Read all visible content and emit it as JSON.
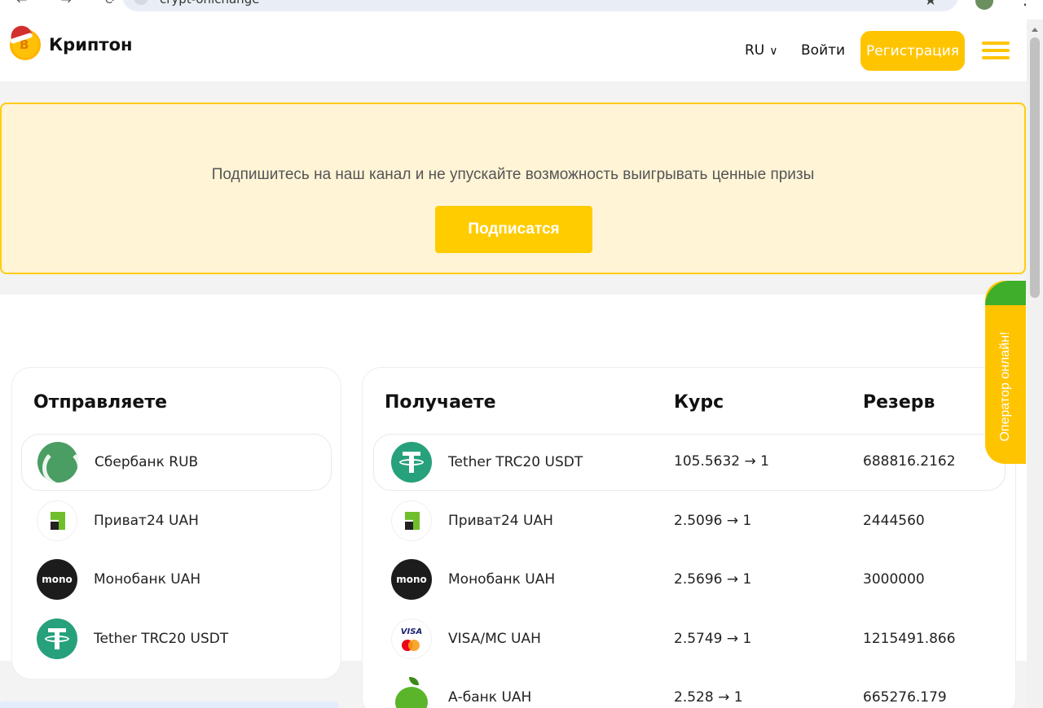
{
  "browser": {
    "url_text": "crypt-onlchange"
  },
  "header": {
    "logo_text": "Криптон",
    "lang": "RU",
    "login": "Войти",
    "register": "Регистрация"
  },
  "banner": {
    "text": "Подпишитесь на наш канал и не упускайте возможность выигрывать ценные призы",
    "button": "Подписатся"
  },
  "send": {
    "title": "Отправляете",
    "items": [
      {
        "name": "Сбербанк RUB",
        "icon": "sberbank-icon"
      },
      {
        "name": "Приват24 UAH",
        "icon": "privat24-icon"
      },
      {
        "name": "Монобанк UAH",
        "icon": "monobank-icon"
      },
      {
        "name": "Tether TRC20 USDT",
        "icon": "tether-icon"
      }
    ]
  },
  "receive": {
    "title": "Получаете",
    "rate_header": "Курс",
    "reserve_header": "Резерв",
    "items": [
      {
        "name": "Tether TRC20 USDT",
        "rate": "105.5632 → 1",
        "reserve": "688816.2162",
        "icon": "tether-icon"
      },
      {
        "name": "Приват24 UAH",
        "rate": "2.5096 → 1",
        "reserve": "2444560",
        "icon": "privat24-icon"
      },
      {
        "name": "Монобанк UAH",
        "rate": "2.5696 → 1",
        "reserve": "3000000",
        "icon": "monobank-icon"
      },
      {
        "name": "VISA/MC UAH",
        "rate": "2.5749 → 1",
        "reserve": "1215491.866",
        "icon": "visa-mc-icon"
      },
      {
        "name": "А-банк UAH",
        "rate": "2.528 → 1",
        "reserve": "665276.179",
        "icon": "abank-icon"
      }
    ]
  },
  "icons": {
    "mono_label": "mono",
    "visa_label": "VISA"
  },
  "operator": {
    "text": "Оператор онлайн!"
  },
  "colors": {
    "accent": "#ffc400",
    "banner_bg": "#fff4d6",
    "tether": "#26a17b",
    "operator_dot": "#3fae2a"
  }
}
